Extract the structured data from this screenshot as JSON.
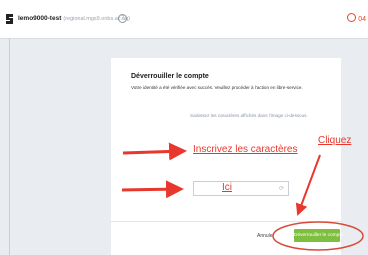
{
  "header": {
    "app_name": "lemo9000-test",
    "app_domain": "(regional.mgs9.onbs.ac.aq)",
    "help_glyph": "?",
    "timer": "04"
  },
  "dialog": {
    "title": "Déverrouiller le compte",
    "description": "Votre identité a été vérifiée avec succès. Veuillez procéder à l'action en libre-service.",
    "instruction": "Saisissez les caractères affichés dans l'image ci-dessous.",
    "captcha_value": "",
    "cancel_label": "Annuler",
    "unlock_label": "Déverrouiller le compte"
  },
  "annotations": {
    "type_chars": "Inscrivez les caractères",
    "here": "Ici",
    "click": "Cliquez"
  },
  "colors": {
    "accent_red": "#e8382d",
    "button_green": "#7fbf3f",
    "timer_orange": "#e8452c"
  },
  "icons": {
    "logo": "app-logo-icon",
    "help": "help-icon",
    "timer": "clock-icon",
    "field": "refresh-icon"
  }
}
